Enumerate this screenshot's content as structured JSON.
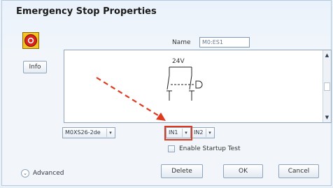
{
  "dialog": {
    "title": "Emergency Stop Properties",
    "name_label": "Name",
    "name_value": "M0:ES1",
    "info_label": "Info"
  },
  "diagram": {
    "voltage_label": "24V"
  },
  "terminals": {
    "module_select": "M0XS26-2de",
    "input_a": "IN1",
    "input_b": "IN2"
  },
  "startup_test_label": "Enable Startup Test",
  "advanced_label": "Advanced",
  "buttons": {
    "delete": "Delete",
    "ok": "OK",
    "cancel": "Cancel"
  },
  "colors": {
    "annotation": "#e03a1e",
    "estop_yellow": "#f3c51e",
    "estop_red": "#d8231a"
  },
  "icons": {
    "estop": "emergency-stop-icon",
    "dropdown": "chevron-down-icon",
    "advanced": "chevron-down-circle-icon"
  }
}
